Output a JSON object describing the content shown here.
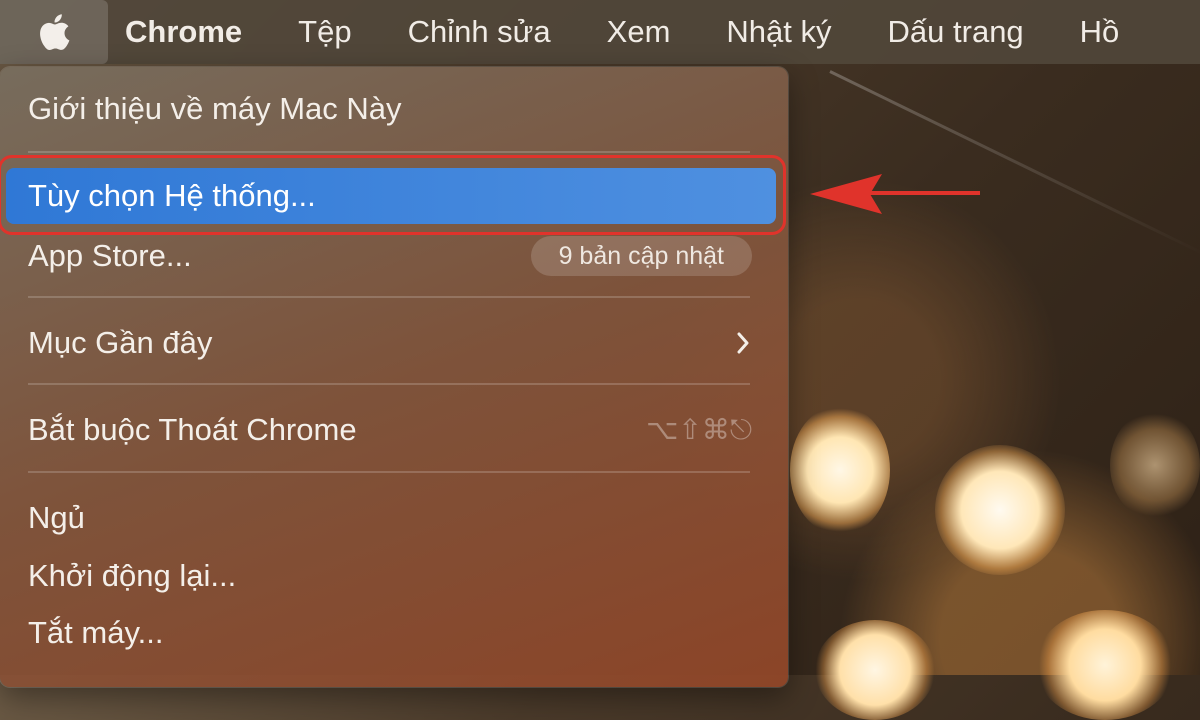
{
  "menubar": {
    "apple_icon": "apple-logo-icon",
    "items": [
      {
        "label": "Chrome"
      },
      {
        "label": "Tệp"
      },
      {
        "label": "Chỉnh sửa"
      },
      {
        "label": "Xem"
      },
      {
        "label": "Nhật ký"
      },
      {
        "label": "Dấu trang"
      },
      {
        "label": "Hồ"
      }
    ]
  },
  "apple_menu": {
    "about": "Giới thiệu về máy Mac Này",
    "system_prefs": "Tùy chọn Hệ thống...",
    "app_store": "App Store...",
    "app_store_badge": "9 bản cập nhật",
    "recent_items": "Mục Gần đây",
    "force_quit": "Bắt buộc Thoát Chrome",
    "force_quit_shortcut": "⌥⇧⌘⎋",
    "sleep": "Ngủ",
    "restart": "Khởi động lại...",
    "shutdown": "Tắt máy..."
  },
  "colors": {
    "highlight": "#3a82dc",
    "annotation": "#e0332b"
  }
}
